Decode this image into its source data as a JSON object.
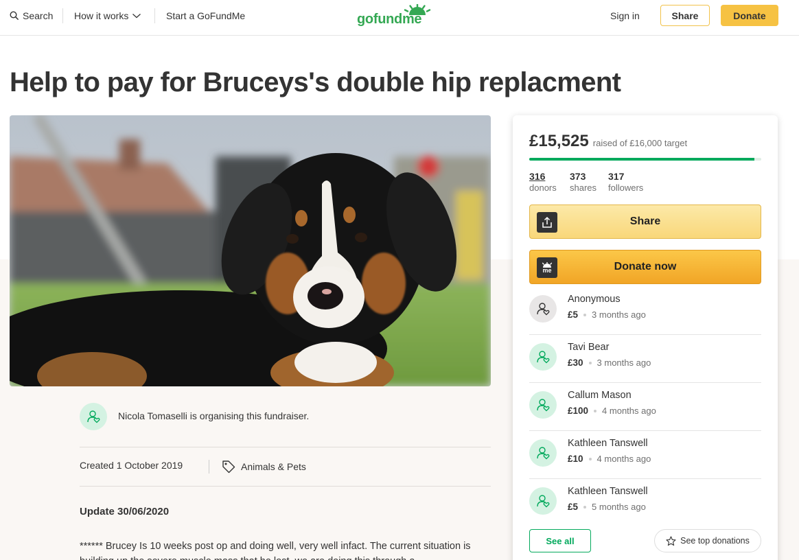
{
  "header": {
    "search_label": "Search",
    "how_label": "How it works",
    "start_label": "Start a GoFundMe",
    "logo_text": "gofundme",
    "signin_label": "Sign in",
    "share_label": "Share",
    "donate_label": "Donate"
  },
  "campaign": {
    "title": "Help to pay for Bruceys's double hip replacment",
    "organiser_text": "Nicola Tomaselli is organising this fundraiser.",
    "created": "Created 1 October 2019",
    "category": "Animals & Pets",
    "update_title": "Update 30/06/2020",
    "story_text": "****** Brucey Is 10 weeks post op and doing well, very well infact. The current situation is building up the severe muscle mass that he lost, we are doing this through a"
  },
  "card": {
    "raised_amount": "£15,525",
    "raised_target": "raised of £16,000 target",
    "progress_fraction": 0.97,
    "stats": [
      {
        "num": "316",
        "label": "donors"
      },
      {
        "num": "373",
        "label": "shares"
      },
      {
        "num": "317",
        "label": "followers"
      }
    ],
    "share_label": "Share",
    "donate_now_label": "Donate now",
    "donate_icon_text": "me",
    "donations": [
      {
        "name": "Anonymous",
        "amount": "£5",
        "time": "3 months ago"
      },
      {
        "name": "Tavi Bear",
        "amount": "£30",
        "time": "3 months ago"
      },
      {
        "name": "Callum Mason",
        "amount": "£100",
        "time": "4 months ago"
      },
      {
        "name": "Kathleen Tanswell",
        "amount": "£10",
        "time": "4 months ago"
      },
      {
        "name": "Kathleen Tanswell",
        "amount": "£5",
        "time": "5 months ago"
      }
    ],
    "see_all_label": "See all",
    "see_top_label": "See top donations"
  },
  "colors": {
    "brand_green": "#02a95c",
    "donate_yellow": "#f6c243",
    "share_yellow": "#fbe197"
  }
}
